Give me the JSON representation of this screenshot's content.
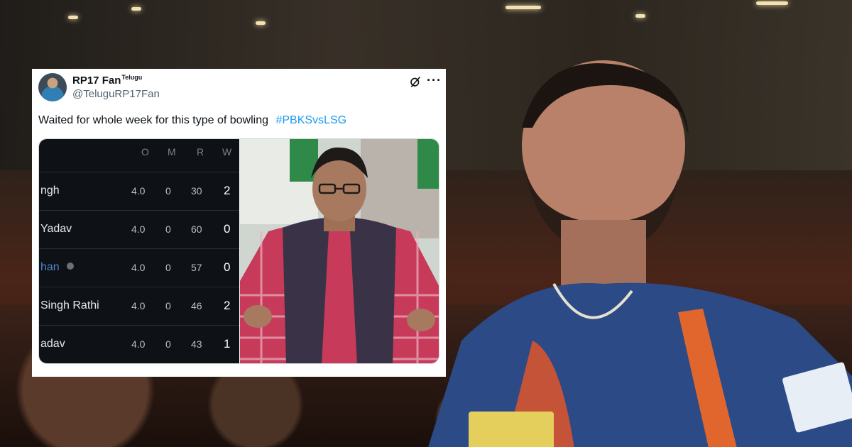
{
  "tweet": {
    "display_name": "RP17 Fan",
    "name_badge": "Telugu",
    "handle": "@TeluguRP17Fan",
    "text": "Waited for whole week for this type of bowling",
    "hashtag": "#PBKSvsLSG",
    "icons": {
      "grok": "grok-icon",
      "more": "more-icon"
    }
  },
  "scorecard": {
    "headers": [
      "O",
      "M",
      "R",
      "W"
    ],
    "rows": [
      {
        "player": "ngh",
        "o": "4.0",
        "m": "0",
        "r": "30",
        "w": "2",
        "highlight": false,
        "dot": false
      },
      {
        "player": "Yadav",
        "o": "4.0",
        "m": "0",
        "r": "60",
        "w": "0",
        "highlight": false,
        "dot": false
      },
      {
        "player": "han",
        "o": "4.0",
        "m": "0",
        "r": "57",
        "w": "0",
        "highlight": true,
        "dot": true
      },
      {
        "player": "Singh Rathi",
        "o": "4.0",
        "m": "0",
        "r": "46",
        "w": "2",
        "highlight": false,
        "dot": false
      },
      {
        "player": "adav",
        "o": "4.0",
        "m": "0",
        "r": "43",
        "w": "1",
        "highlight": false,
        "dot": false
      }
    ]
  },
  "colors": {
    "hashtag": "#1d9bf0",
    "handle": "#536471",
    "card_bg": "#ffffff",
    "score_bg": "#0e1116",
    "highlight_player": "#4d86c9"
  }
}
